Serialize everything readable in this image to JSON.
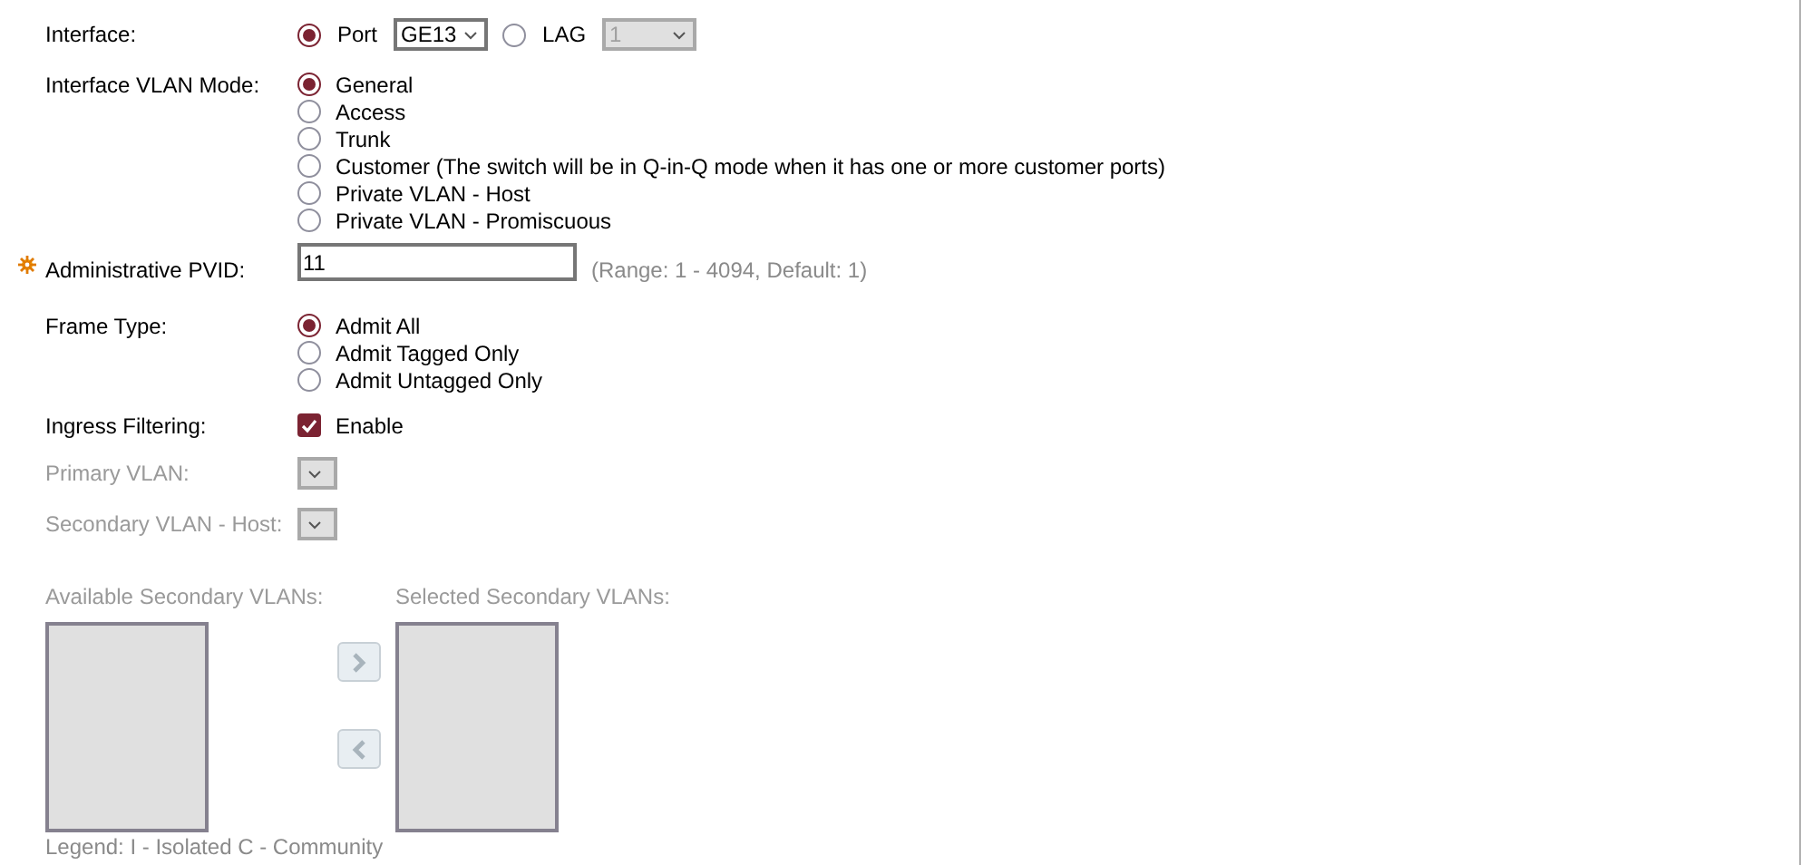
{
  "interface": {
    "label": "Interface:",
    "options": [
      {
        "label": "Port",
        "selected": true,
        "select_value": "GE13",
        "disabled": false
      },
      {
        "label": "LAG",
        "selected": false,
        "select_value": "1",
        "disabled": true
      }
    ]
  },
  "vlan_mode": {
    "label": "Interface VLAN Mode:",
    "options": [
      {
        "label": "General",
        "selected": true
      },
      {
        "label": "Access",
        "selected": false
      },
      {
        "label": "Trunk",
        "selected": false
      },
      {
        "label": "Customer (The switch will be in Q-in-Q mode when it has one or more customer ports)",
        "selected": false
      },
      {
        "label": "Private VLAN - Host",
        "selected": false
      },
      {
        "label": "Private VLAN - Promiscuous",
        "selected": false
      }
    ]
  },
  "pvid": {
    "label": "Administrative PVID:",
    "required": true,
    "value": "11",
    "hint": "(Range: 1 - 4094, Default: 1)"
  },
  "frame_type": {
    "label": "Frame Type:",
    "options": [
      {
        "label": "Admit All",
        "selected": true
      },
      {
        "label": "Admit Tagged Only",
        "selected": false
      },
      {
        "label": "Admit Untagged Only",
        "selected": false
      }
    ]
  },
  "ingress_filtering": {
    "label": "Ingress Filtering:",
    "option": "Enable",
    "checked": true
  },
  "primary_vlan": {
    "label": "Primary VLAN:",
    "disabled": true
  },
  "secondary_vlan_host": {
    "label": "Secondary VLAN - Host:",
    "disabled": true
  },
  "secondary_vlans": {
    "available_label": "Available Secondary VLANs:",
    "selected_label": "Selected Secondary VLANs:",
    "disabled": true
  },
  "legend": "Legend: I - Isolated C - Community"
}
